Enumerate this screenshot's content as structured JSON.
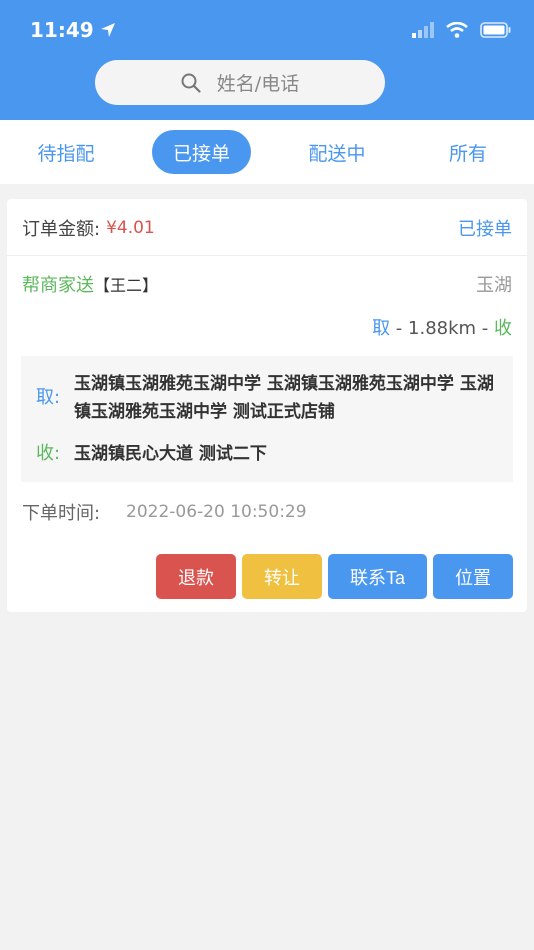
{
  "status_bar": {
    "time": "11:49"
  },
  "search": {
    "placeholder": "姓名/电话"
  },
  "tabs": [
    {
      "label": "待指配",
      "active": false
    },
    {
      "label": "已接单",
      "active": true
    },
    {
      "label": "配送中",
      "active": false
    },
    {
      "label": "所有",
      "active": false
    }
  ],
  "order": {
    "amount_label": "订单金额:",
    "amount_value": "¥4.01",
    "status": "已接单",
    "type": "帮商家送",
    "rider": "【王二】",
    "area": "玉湖",
    "distance_pick": "取",
    "distance_value": " - 1.88km - ",
    "distance_recv": "收",
    "pickup_tag": "取:",
    "pickup_address": "玉湖镇玉湖雅苑玉湖中学 玉湖镇玉湖雅苑玉湖中学 玉湖镇玉湖雅苑玉湖中学 测试正式店铺",
    "receive_tag": "收:",
    "receive_address": "玉湖镇民心大道 测试二下",
    "time_label": "下单时间:",
    "time_value": "2022-06-20 10:50:29"
  },
  "actions": {
    "refund": "退款",
    "transfer": "转让",
    "contact": "联系Ta",
    "location": "位置"
  },
  "colors": {
    "primary": "#4a97f0",
    "refund": "#d9534f",
    "transfer": "#f0c040",
    "green": "#5cb85c"
  }
}
